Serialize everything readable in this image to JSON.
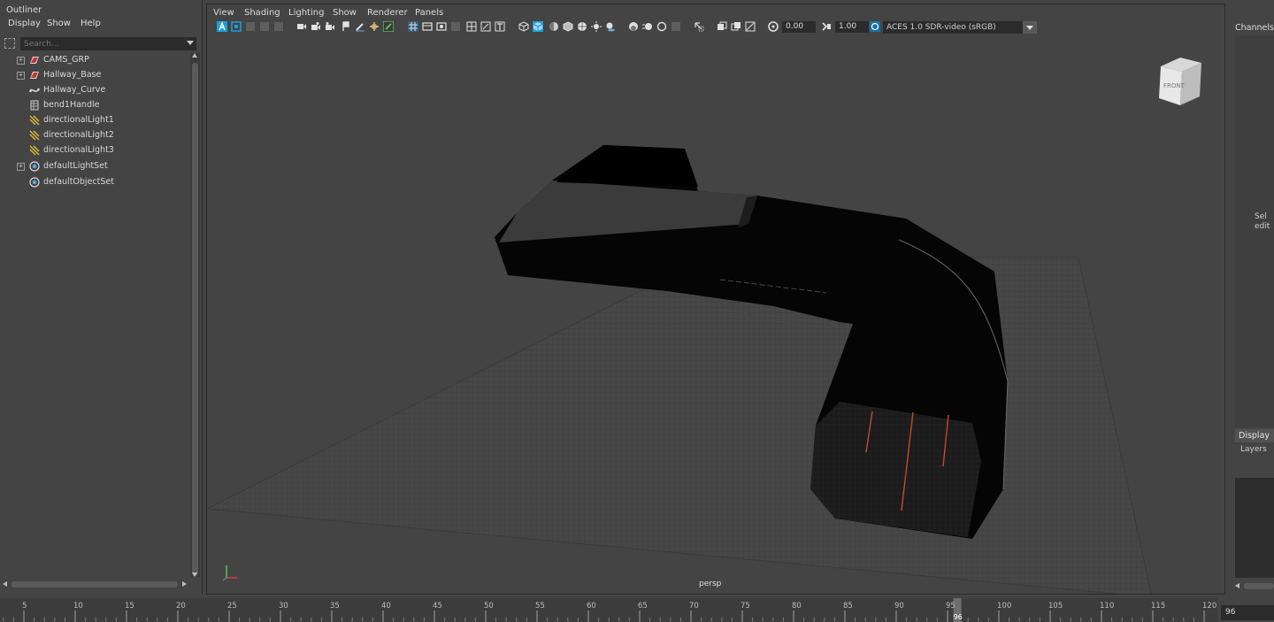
{
  "outliner": {
    "title": "Outliner",
    "menu": [
      "Display",
      "Show",
      "Help"
    ],
    "search_placeholder": "Search...",
    "items": [
      {
        "label": "CAMS_GRP",
        "expandable": true,
        "icon": "group-icon"
      },
      {
        "label": "Hallway_Base",
        "expandable": true,
        "icon": "group-icon"
      },
      {
        "label": "Hallway_Curve",
        "expandable": false,
        "icon": "curve-icon"
      },
      {
        "label": "bend1Handle",
        "expandable": false,
        "icon": "deformer-handle-icon"
      },
      {
        "label": "directionalLight1",
        "expandable": false,
        "icon": "directional-light-icon"
      },
      {
        "label": "directionalLight2",
        "expandable": false,
        "icon": "directional-light-icon"
      },
      {
        "label": "directionalLight3",
        "expandable": false,
        "icon": "directional-light-icon"
      },
      {
        "label": "defaultLightSet",
        "expandable": true,
        "icon": "set-icon"
      },
      {
        "label": "defaultObjectSet",
        "expandable": false,
        "icon": "set-icon"
      }
    ]
  },
  "viewport": {
    "menu": [
      "View",
      "Shading",
      "Lighting",
      "Show",
      "Renderer",
      "Panels"
    ],
    "exposure": "0.00",
    "gamma": "1.00",
    "color_space": "ACES 1.0 SDR-video (sRGB)",
    "camera_label": "persp",
    "view_cube_label": "FRONT",
    "accent_color": "#1aa0dc"
  },
  "channels": {
    "title": "Channels",
    "hint_line1": "Sel",
    "hint_line2": "edit"
  },
  "layers": {
    "tab": "Display",
    "sub": "Layers"
  },
  "timeline": {
    "ticks": [
      "5",
      "10",
      "15",
      "20",
      "25",
      "30",
      "35",
      "40",
      "45",
      "50",
      "55",
      "60",
      "65",
      "70",
      "75",
      "80",
      "85",
      "90",
      "95",
      "100",
      "105",
      "110",
      "115",
      "120"
    ],
    "current_frame": "96",
    "current_frame_field": "96"
  }
}
